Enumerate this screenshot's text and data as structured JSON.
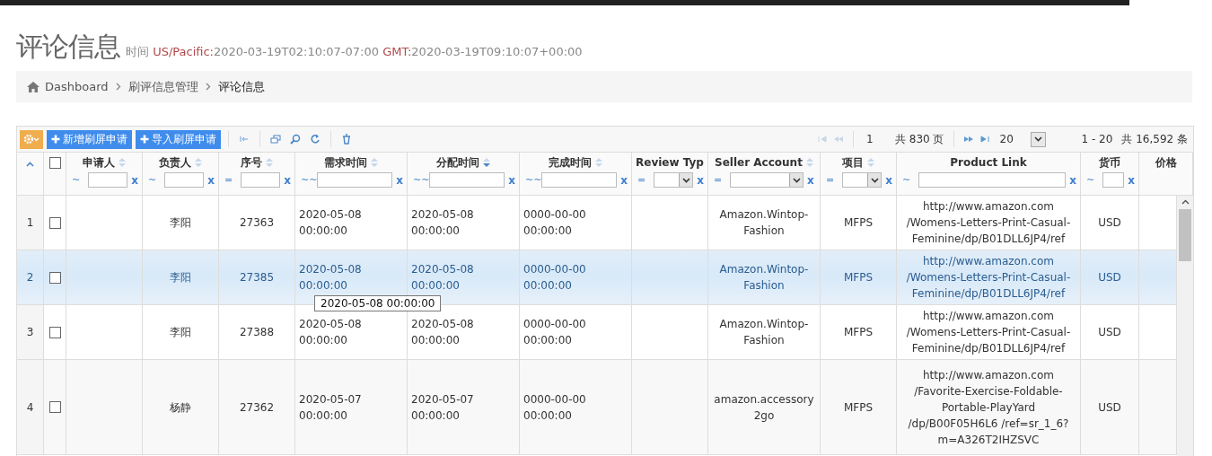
{
  "page": {
    "title": "评论信息",
    "time_label": "时间",
    "tz1": "US/Pacific:",
    "time1": "2020-03-19T02:10:07-07:00",
    "tz2": "GMT:",
    "time2": "2020-03-19T09:10:07+00:00"
  },
  "breadcrumb": [
    {
      "label": "Dashboard",
      "kind": "home"
    },
    {
      "label": "刷评信息管理",
      "kind": "link"
    },
    {
      "label": "评论信息",
      "kind": "current"
    }
  ],
  "toolbar": {
    "buttons": [
      "新增刷屏申请",
      "导入刷屏申请"
    ]
  },
  "pager": {
    "page": "1",
    "pages": "共 830 页",
    "page_size": "20",
    "summary": "1 - 20",
    "total": "共 16,592 条"
  },
  "columns": [
    {
      "kind": "rownum"
    },
    {
      "kind": "check",
      "checked": false
    },
    {
      "kind": "data",
      "label": "申请人",
      "sortable": true,
      "sorted_desc": false,
      "op": "~",
      "dropdown": false,
      "clear": "x"
    },
    {
      "kind": "data",
      "label": "负责人",
      "sortable": true,
      "sorted_desc": false,
      "op": "~",
      "dropdown": false,
      "clear": "x"
    },
    {
      "kind": "data",
      "label": "序号",
      "sortable": true,
      "sorted_desc": false,
      "op": "=",
      "dropdown": false,
      "clear": "x"
    },
    {
      "kind": "data",
      "label": "需求时间",
      "sortable": true,
      "sorted_desc": false,
      "op": "~~",
      "dropdown": false,
      "clear": "x"
    },
    {
      "kind": "data",
      "label": "分配时间",
      "sortable": true,
      "sorted_desc": true,
      "op": "~~",
      "dropdown": false,
      "clear": "x"
    },
    {
      "kind": "data",
      "label": "完成时间",
      "sortable": true,
      "sorted_desc": false,
      "op": "~~",
      "dropdown": false,
      "clear": "x"
    },
    {
      "kind": "data",
      "label": "Review Typ",
      "sortable": false,
      "op": "=",
      "dropdown": true,
      "clear": "x"
    },
    {
      "kind": "data",
      "label": "Seller Account",
      "sortable": true,
      "sorted_desc": false,
      "op": "=",
      "dropdown": true,
      "clear": "x"
    },
    {
      "kind": "data",
      "label": "项目",
      "sortable": true,
      "sorted_desc": false,
      "op": "=",
      "dropdown": true,
      "clear": "x"
    },
    {
      "kind": "data",
      "label": "Product Link",
      "sortable": false,
      "op": "~",
      "dropdown": false,
      "clear": "x"
    },
    {
      "kind": "data",
      "label": "货币",
      "sortable": false,
      "op": "~",
      "dropdown": false,
      "clear": "x"
    },
    {
      "kind": "data",
      "label": "价格",
      "sortable": false
    }
  ],
  "rows": [
    {
      "num": "1",
      "selected": false,
      "checked": false,
      "cells": [
        "",
        "李阳",
        "27363",
        "2020-05-08 00:00:00",
        "2020-05-08 00:00:00",
        "0000-00-00 00:00:00",
        "",
        "Amazon.Wintop-Fashion",
        "MFPS",
        "http://www.amazon.com /Womens-Letters-Print-Casual-Feminine/dp/B01DLL6JP4/ref",
        "USD",
        ""
      ]
    },
    {
      "num": "2",
      "selected": true,
      "checked": false,
      "cells": [
        "",
        "李阳",
        "27385",
        "2020-05-08 00:00:00",
        "2020-05-08 00:00:00",
        "0000-00-00 00:00:00",
        "",
        "Amazon.Wintop-Fashion",
        "MFPS",
        "http://www.amazon.com /Womens-Letters-Print-Casual-Feminine/dp/B01DLL6JP4/ref",
        "USD",
        ""
      ]
    },
    {
      "num": "3",
      "selected": false,
      "checked": false,
      "cells": [
        "",
        "李阳",
        "27388",
        "2020-05-08 00:00:00",
        "2020-05-08 00:00:00",
        "0000-00-00 00:00:00",
        "",
        "Amazon.Wintop-Fashion",
        "MFPS",
        "http://www.amazon.com /Womens-Letters-Print-Casual-Feminine/dp/B01DLL6JP4/ref",
        "USD",
        ""
      ]
    },
    {
      "num": "4",
      "selected": false,
      "checked": false,
      "cells": [
        "",
        "杨静",
        "27362",
        "2020-05-07 00:00:00",
        "2020-05-07 00:00:00",
        "0000-00-00 00:00:00",
        "",
        "amazon.accessory 2go",
        "MFPS",
        "http://www.amazon.com /Favorite-Exercise-Foldable-Portable-PlayYard /dp/B00F05H6L6 /ref=sr_1_6?m=A326T2IHZSVC",
        "USD",
        ""
      ]
    }
  ],
  "tooltip": "2020-05-08 00:00:00"
}
